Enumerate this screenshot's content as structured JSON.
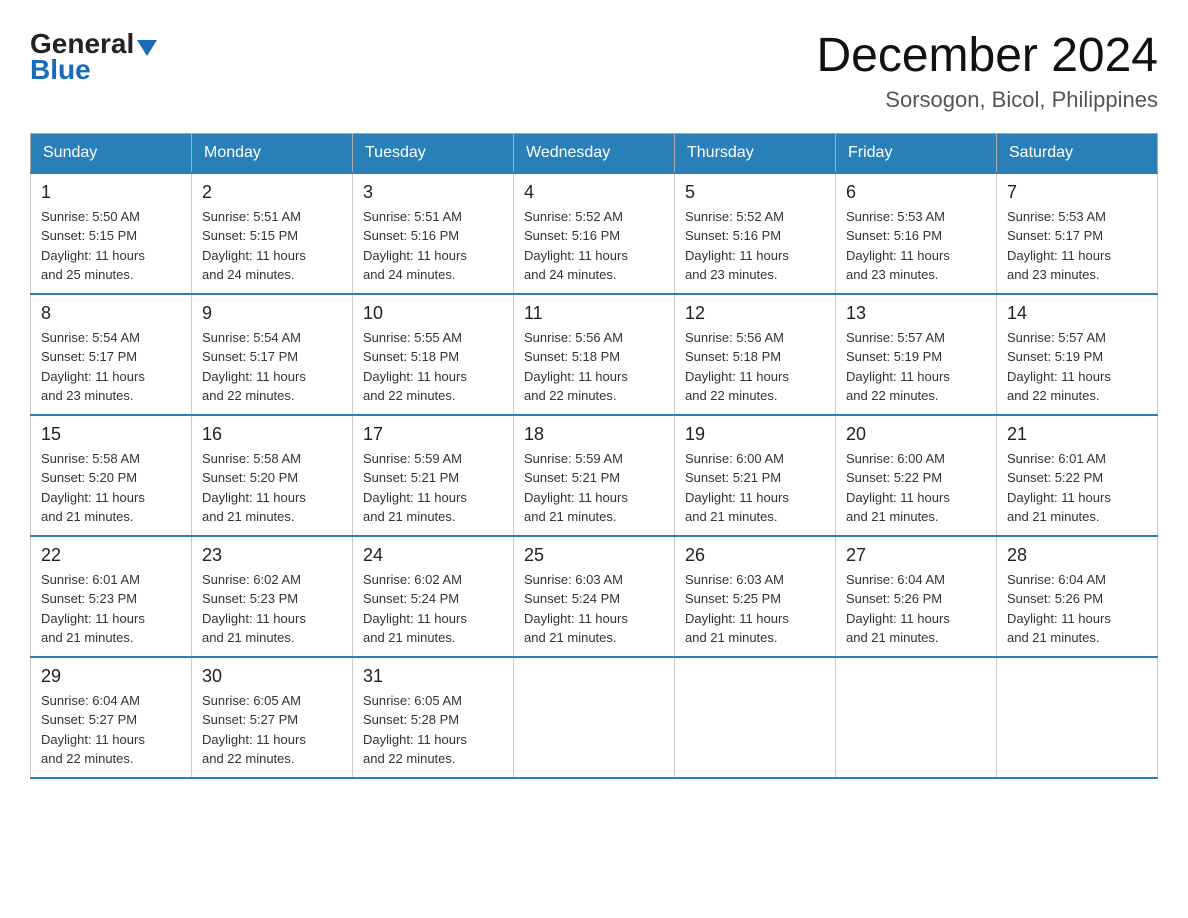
{
  "logo": {
    "general": "General",
    "blue": "Blue"
  },
  "header": {
    "month": "December 2024",
    "location": "Sorsogon, Bicol, Philippines"
  },
  "weekdays": [
    "Sunday",
    "Monday",
    "Tuesday",
    "Wednesday",
    "Thursday",
    "Friday",
    "Saturday"
  ],
  "weeks": [
    [
      {
        "day": "1",
        "sunrise": "5:50 AM",
        "sunset": "5:15 PM",
        "daylight": "11 hours and 25 minutes."
      },
      {
        "day": "2",
        "sunrise": "5:51 AM",
        "sunset": "5:15 PM",
        "daylight": "11 hours and 24 minutes."
      },
      {
        "day": "3",
        "sunrise": "5:51 AM",
        "sunset": "5:16 PM",
        "daylight": "11 hours and 24 minutes."
      },
      {
        "day": "4",
        "sunrise": "5:52 AM",
        "sunset": "5:16 PM",
        "daylight": "11 hours and 24 minutes."
      },
      {
        "day": "5",
        "sunrise": "5:52 AM",
        "sunset": "5:16 PM",
        "daylight": "11 hours and 23 minutes."
      },
      {
        "day": "6",
        "sunrise": "5:53 AM",
        "sunset": "5:16 PM",
        "daylight": "11 hours and 23 minutes."
      },
      {
        "day": "7",
        "sunrise": "5:53 AM",
        "sunset": "5:17 PM",
        "daylight": "11 hours and 23 minutes."
      }
    ],
    [
      {
        "day": "8",
        "sunrise": "5:54 AM",
        "sunset": "5:17 PM",
        "daylight": "11 hours and 23 minutes."
      },
      {
        "day": "9",
        "sunrise": "5:54 AM",
        "sunset": "5:17 PM",
        "daylight": "11 hours and 22 minutes."
      },
      {
        "day": "10",
        "sunrise": "5:55 AM",
        "sunset": "5:18 PM",
        "daylight": "11 hours and 22 minutes."
      },
      {
        "day": "11",
        "sunrise": "5:56 AM",
        "sunset": "5:18 PM",
        "daylight": "11 hours and 22 minutes."
      },
      {
        "day": "12",
        "sunrise": "5:56 AM",
        "sunset": "5:18 PM",
        "daylight": "11 hours and 22 minutes."
      },
      {
        "day": "13",
        "sunrise": "5:57 AM",
        "sunset": "5:19 PM",
        "daylight": "11 hours and 22 minutes."
      },
      {
        "day": "14",
        "sunrise": "5:57 AM",
        "sunset": "5:19 PM",
        "daylight": "11 hours and 22 minutes."
      }
    ],
    [
      {
        "day": "15",
        "sunrise": "5:58 AM",
        "sunset": "5:20 PM",
        "daylight": "11 hours and 21 minutes."
      },
      {
        "day": "16",
        "sunrise": "5:58 AM",
        "sunset": "5:20 PM",
        "daylight": "11 hours and 21 minutes."
      },
      {
        "day": "17",
        "sunrise": "5:59 AM",
        "sunset": "5:21 PM",
        "daylight": "11 hours and 21 minutes."
      },
      {
        "day": "18",
        "sunrise": "5:59 AM",
        "sunset": "5:21 PM",
        "daylight": "11 hours and 21 minutes."
      },
      {
        "day": "19",
        "sunrise": "6:00 AM",
        "sunset": "5:21 PM",
        "daylight": "11 hours and 21 minutes."
      },
      {
        "day": "20",
        "sunrise": "6:00 AM",
        "sunset": "5:22 PM",
        "daylight": "11 hours and 21 minutes."
      },
      {
        "day": "21",
        "sunrise": "6:01 AM",
        "sunset": "5:22 PM",
        "daylight": "11 hours and 21 minutes."
      }
    ],
    [
      {
        "day": "22",
        "sunrise": "6:01 AM",
        "sunset": "5:23 PM",
        "daylight": "11 hours and 21 minutes."
      },
      {
        "day": "23",
        "sunrise": "6:02 AM",
        "sunset": "5:23 PM",
        "daylight": "11 hours and 21 minutes."
      },
      {
        "day": "24",
        "sunrise": "6:02 AM",
        "sunset": "5:24 PM",
        "daylight": "11 hours and 21 minutes."
      },
      {
        "day": "25",
        "sunrise": "6:03 AM",
        "sunset": "5:24 PM",
        "daylight": "11 hours and 21 minutes."
      },
      {
        "day": "26",
        "sunrise": "6:03 AM",
        "sunset": "5:25 PM",
        "daylight": "11 hours and 21 minutes."
      },
      {
        "day": "27",
        "sunrise": "6:04 AM",
        "sunset": "5:26 PM",
        "daylight": "11 hours and 21 minutes."
      },
      {
        "day": "28",
        "sunrise": "6:04 AM",
        "sunset": "5:26 PM",
        "daylight": "11 hours and 21 minutes."
      }
    ],
    [
      {
        "day": "29",
        "sunrise": "6:04 AM",
        "sunset": "5:27 PM",
        "daylight": "11 hours and 22 minutes."
      },
      {
        "day": "30",
        "sunrise": "6:05 AM",
        "sunset": "5:27 PM",
        "daylight": "11 hours and 22 minutes."
      },
      {
        "day": "31",
        "sunrise": "6:05 AM",
        "sunset": "5:28 PM",
        "daylight": "11 hours and 22 minutes."
      },
      null,
      null,
      null,
      null
    ]
  ],
  "labels": {
    "sunrise": "Sunrise:",
    "sunset": "Sunset:",
    "daylight": "Daylight:"
  }
}
